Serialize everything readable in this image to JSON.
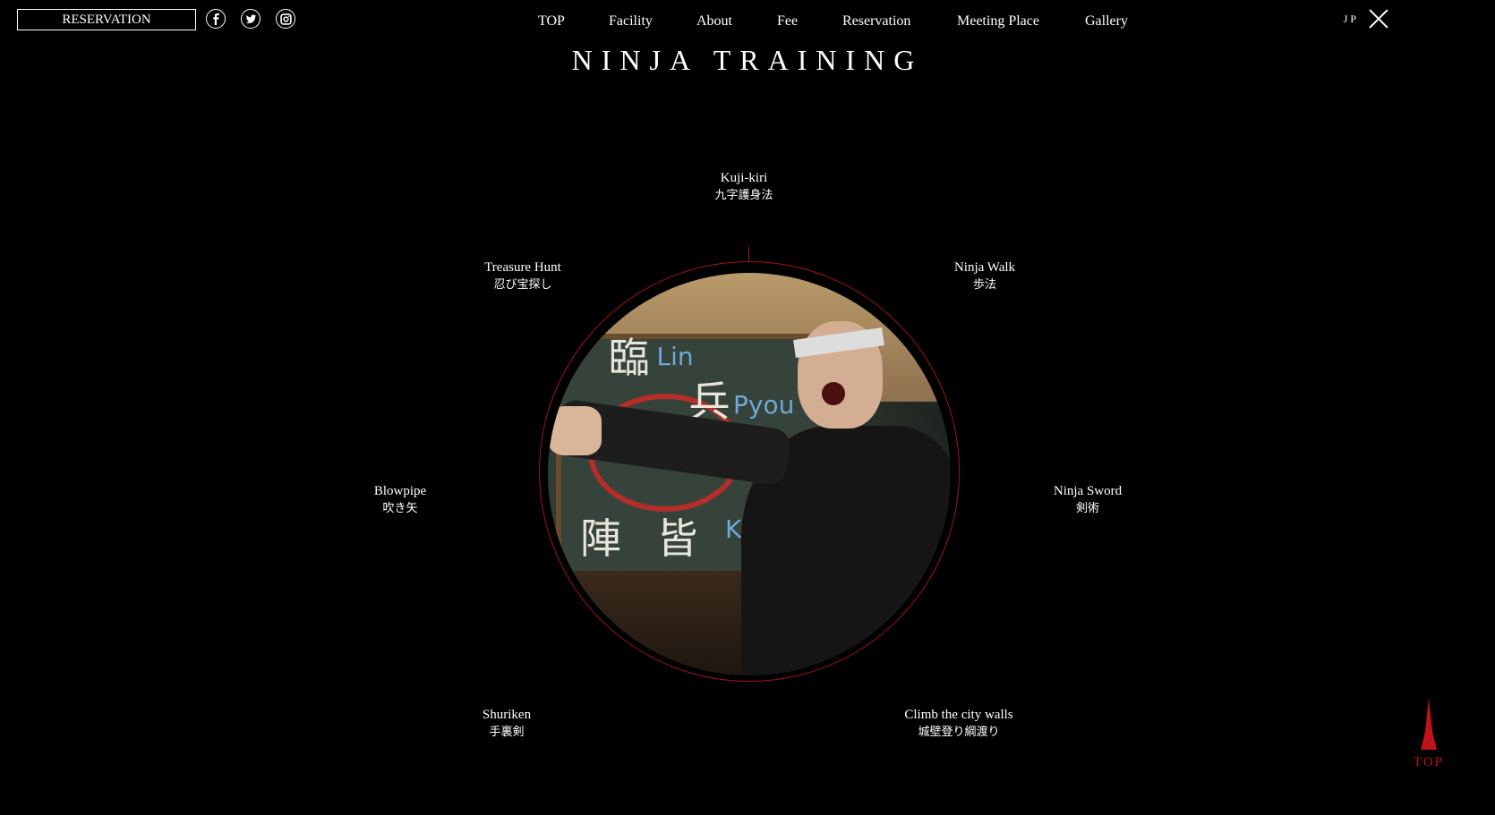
{
  "header": {
    "reservation_button": "RESERVATION",
    "social": [
      {
        "icon": "facebook-icon",
        "glyph": "f"
      },
      {
        "icon": "twitter-icon",
        "glyph": "t"
      },
      {
        "icon": "instagram-icon",
        "glyph": "i"
      }
    ],
    "nav": [
      "TOP",
      "Facility",
      "About",
      "Fee",
      "Reservation",
      "Meeting Place",
      "Gallery"
    ],
    "lang": "JP"
  },
  "page": {
    "title": "NINJA TRAINING"
  },
  "trainings": [
    {
      "en": "Kuji-kiri",
      "jp": "九字護身法"
    },
    {
      "en": "Treasure Hunt",
      "jp": "忍び宝探し"
    },
    {
      "en": "Ninja Walk",
      "jp": "歩法"
    },
    {
      "en": "Blowpipe",
      "jp": "吹き矢"
    },
    {
      "en": "Ninja Sword",
      "jp": "剣術"
    },
    {
      "en": "Shuriken",
      "jp": "手裏剣"
    },
    {
      "en": "Climb the city walls",
      "jp": "城壁登り綱渡り"
    }
  ],
  "photo": {
    "board_kanji": [
      "臨",
      "兵",
      "陣",
      "皆"
    ],
    "board_romaji": [
      "Lin",
      "Pyou",
      "Kai"
    ]
  },
  "back_to_top": "TOP",
  "colors": {
    "accent": "#c0141c",
    "ring": "#a0141c",
    "background": "#000000",
    "text": "#ffffff"
  }
}
